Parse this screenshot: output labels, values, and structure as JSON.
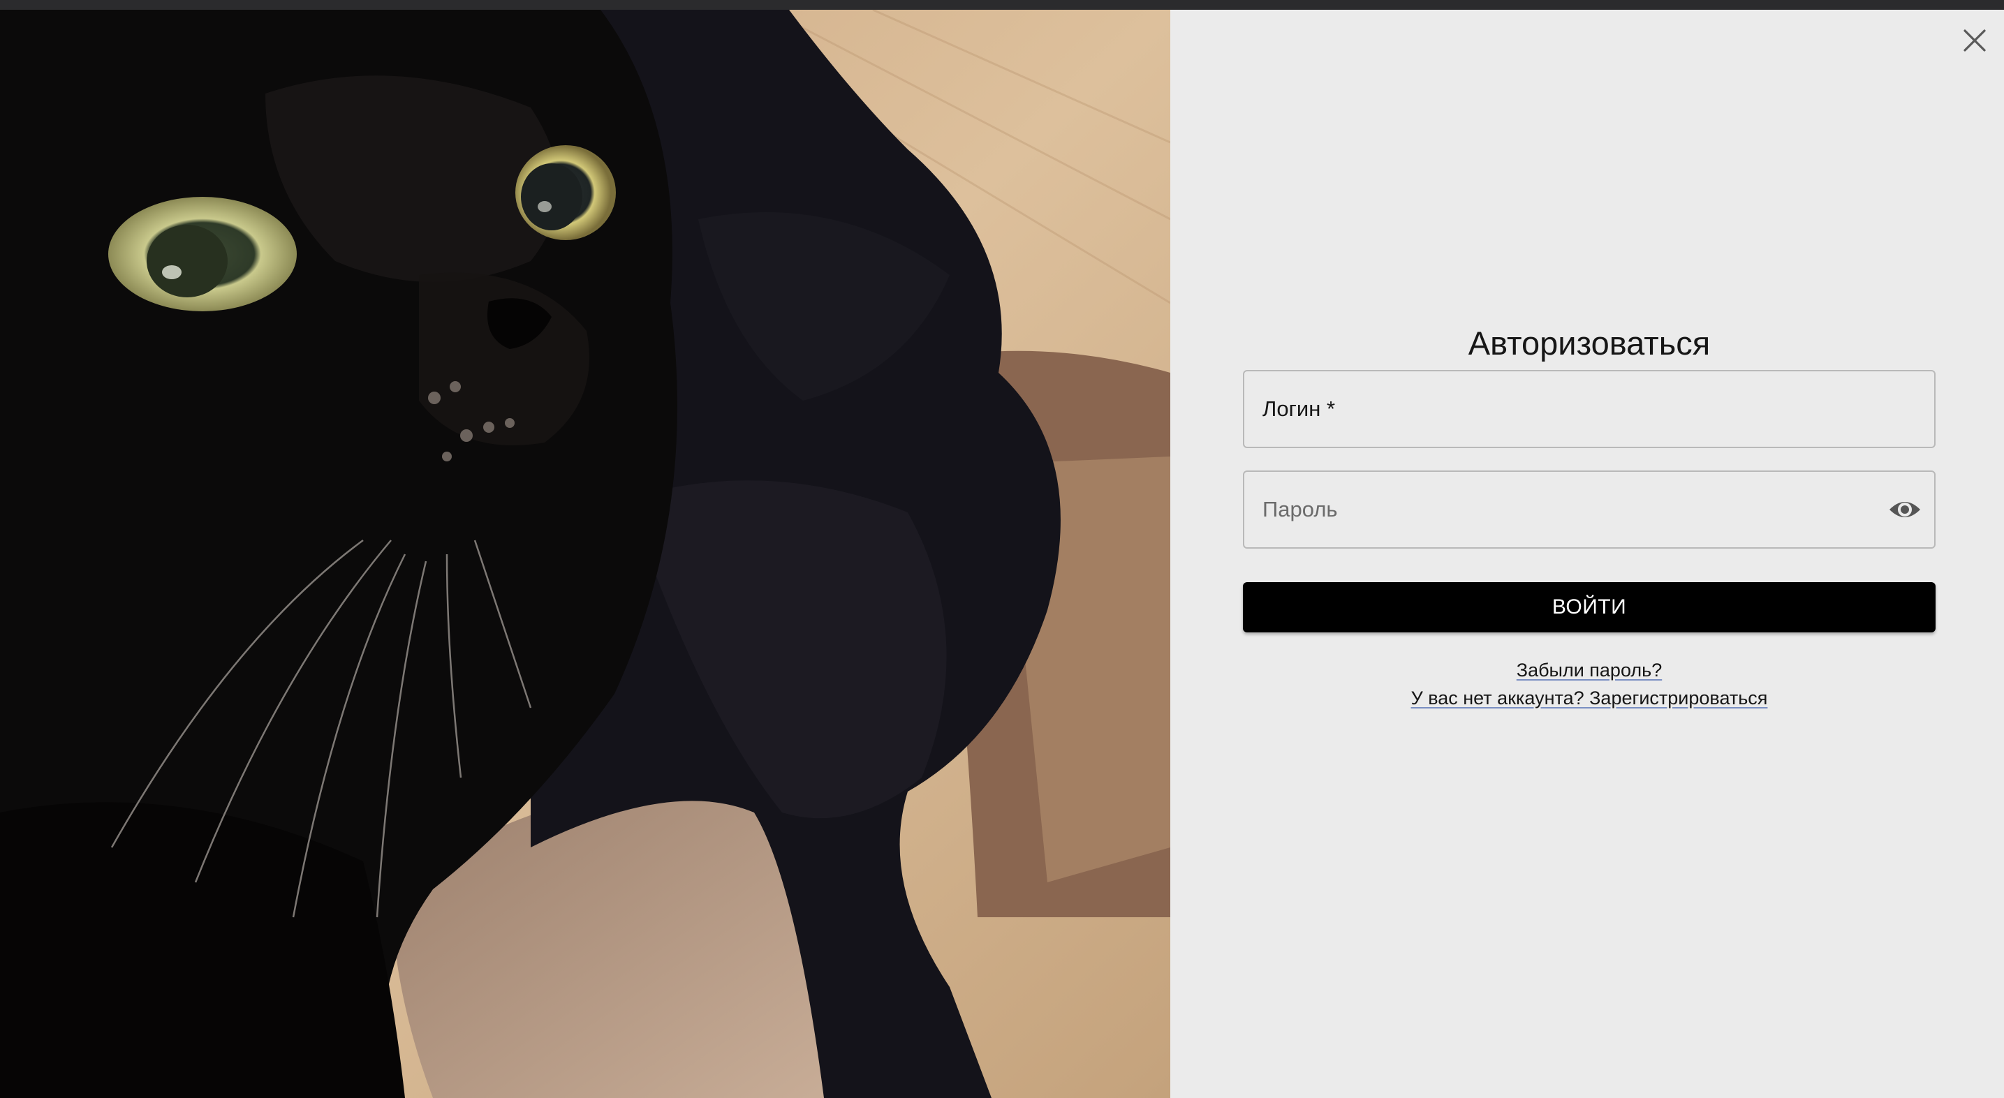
{
  "dialog": {
    "title": "Авторизоваться",
    "close_icon": "close-icon"
  },
  "form": {
    "login": {
      "placeholder": "Логин *",
      "value": ""
    },
    "password": {
      "placeholder": "Пароль",
      "value": "",
      "toggle_icon": "eye-icon"
    },
    "submit_label": "ВОЙТИ"
  },
  "links": {
    "forgot_password": "Забыли пароль?",
    "register": "У вас нет аккаунта? Зарегистрироваться"
  },
  "colors": {
    "panel_background": "#ebebeb",
    "button_background": "#000000",
    "button_text": "#ffffff",
    "link_underline": "#7a8fc2"
  }
}
